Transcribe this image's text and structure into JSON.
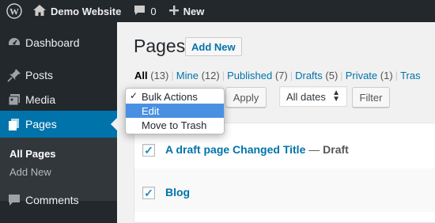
{
  "adminbar": {
    "site_name": "Demo Website",
    "comments_count": "0",
    "new_label": "New"
  },
  "sidebar": {
    "items": [
      {
        "label": "Dashboard",
        "icon": "dashboard-icon"
      },
      {
        "label": "Posts",
        "icon": "pin-icon"
      },
      {
        "label": "Media",
        "icon": "media-icon"
      },
      {
        "label": "Pages",
        "icon": "pages-icon"
      },
      {
        "label": "Comments",
        "icon": "comment-icon"
      }
    ],
    "submenu": [
      "All Pages",
      "Add New"
    ]
  },
  "main": {
    "title": "Pages",
    "add_new": "Add New",
    "filters": [
      {
        "label": "All",
        "count": "(13)"
      },
      {
        "label": "Mine",
        "count": "(12)"
      },
      {
        "label": "Published",
        "count": "(7)"
      },
      {
        "label": "Drafts",
        "count": "(5)"
      },
      {
        "label": "Private",
        "count": "(1)"
      },
      {
        "label": "Tras",
        "count": ""
      }
    ],
    "bulk_actions": {
      "options": [
        "Bulk Actions",
        "Edit",
        "Move to Trash"
      ],
      "selected": "Bulk Actions",
      "highlighted": "Edit"
    },
    "apply": "Apply",
    "dates_select": "All dates",
    "filter": "Filter",
    "rows": [
      {
        "title": "A draft page Changed Title",
        "dash": " — ",
        "state": "Draft",
        "checked": true
      },
      {
        "title": "Blog",
        "dash": "",
        "state": "",
        "checked": true
      }
    ]
  },
  "colors": {
    "accent": "#0073aa",
    "adminbar_bg": "#23282d",
    "submenu_bg": "#32373c",
    "dropdown_highlight": "#4a90e2"
  }
}
